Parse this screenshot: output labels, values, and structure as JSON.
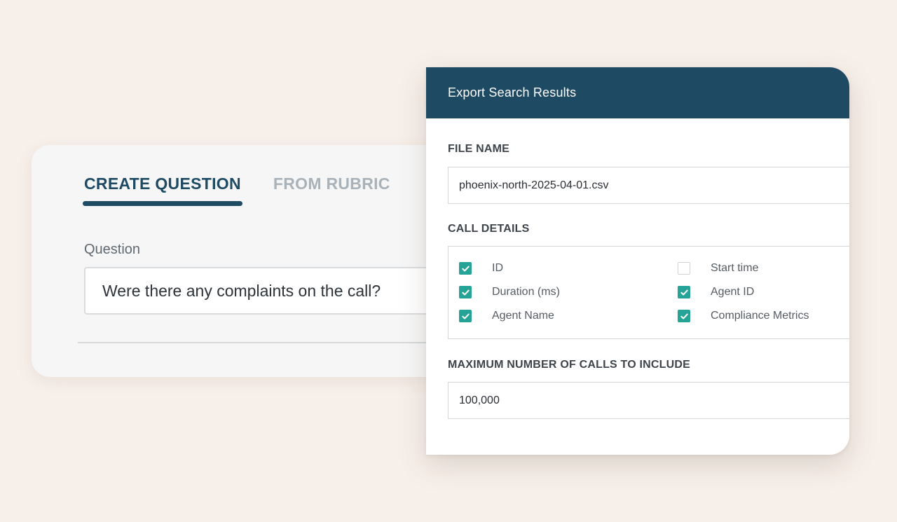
{
  "question_builder": {
    "tabs": [
      {
        "label": "CREATE QUESTION",
        "active": true
      },
      {
        "label": "FROM RUBRIC",
        "active": false
      }
    ],
    "question_label": "Question",
    "question_value": "Were there any complaints on the call?"
  },
  "export_dialog": {
    "title": "Export Search Results",
    "file_name_label": "FILE NAME",
    "file_name_value": "phoenix-north-2025-04-01.csv",
    "call_details_label": "CALL DETAILS",
    "call_details": [
      {
        "label": "ID",
        "checked": true
      },
      {
        "label": "Start time",
        "checked": false
      },
      {
        "label": "Duration (ms)",
        "checked": true
      },
      {
        "label": "Agent ID",
        "checked": true
      },
      {
        "label": "Agent Name",
        "checked": true
      },
      {
        "label": "Compliance Metrics",
        "checked": true
      }
    ],
    "max_calls_label": "MAXIMUM NUMBER OF CALLS TO INCLUDE",
    "max_calls_value": "100,000"
  },
  "colors": {
    "background": "#f7efe9",
    "header": "#1f4a64",
    "accent_tab": "#1e4a63",
    "checkbox": "#25a396"
  },
  "icons": {
    "checkbox_checked": "checkmark-icon"
  }
}
